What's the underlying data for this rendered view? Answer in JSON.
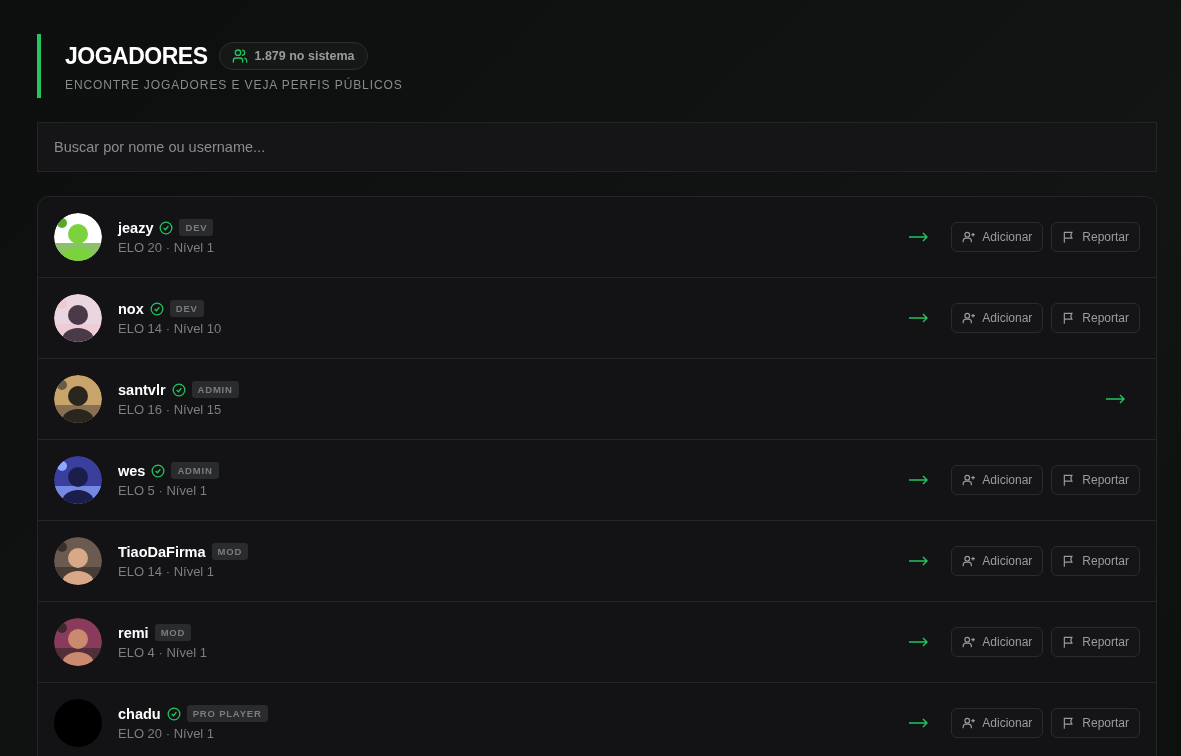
{
  "header": {
    "title": "JOGADORES",
    "count": "1.879 no sistema",
    "subtitle": "ENCONTRE JOGADORES E VEJA PERFIS PÚBLICOS"
  },
  "search": {
    "placeholder": "Buscar por nome ou username..."
  },
  "players": [
    {
      "name": "jeazy",
      "verified": true,
      "role": "DEV",
      "stats": "ELO 20 · Nível 1",
      "buttons": [
        {
          "kind": "add",
          "label": "Adicionar"
        },
        {
          "kind": "report",
          "label": "Reportar"
        }
      ]
    },
    {
      "name": "nox",
      "verified": true,
      "role": "DEV",
      "stats": "ELO 14 · Nível 10",
      "buttons": [
        {
          "kind": "add",
          "label": "Adicionar"
        },
        {
          "kind": "report",
          "label": "Reportar"
        }
      ]
    },
    {
      "name": "santvlr",
      "verified": true,
      "role": "ADMIN",
      "stats": "ELO 16 · Nível 15"
    },
    {
      "name": "wes",
      "verified": true,
      "role": "ADMIN",
      "stats": "ELO 5 · Nível 1",
      "buttons": [
        {
          "kind": "add",
          "label": "Adicionar"
        },
        {
          "kind": "report",
          "label": "Reportar"
        }
      ]
    },
    {
      "name": "TiaoDaFirma",
      "verified": false,
      "role": "MOD",
      "stats": "ELO 14 · Nível 1",
      "buttons": [
        {
          "kind": "add",
          "label": "Adicionar"
        },
        {
          "kind": "report",
          "label": "Reportar"
        }
      ]
    },
    {
      "name": "remi",
      "verified": false,
      "role": "MOD",
      "stats": "ELO 4 · Nível 1",
      "buttons": [
        {
          "kind": "add",
          "label": "Adicionar"
        },
        {
          "kind": "report",
          "label": "Reportar"
        }
      ]
    },
    {
      "name": "chadu",
      "verified": true,
      "role": "PRO PLAYER",
      "stats": "ELO 20 · Nível 1",
      "avatar": {
        "kind": "blank"
      },
      "buttons": [
        {
          "kind": "add",
          "label": "Adicionar"
        },
        {
          "kind": "report",
          "label": "Reportar"
        }
      ]
    }
  ]
}
